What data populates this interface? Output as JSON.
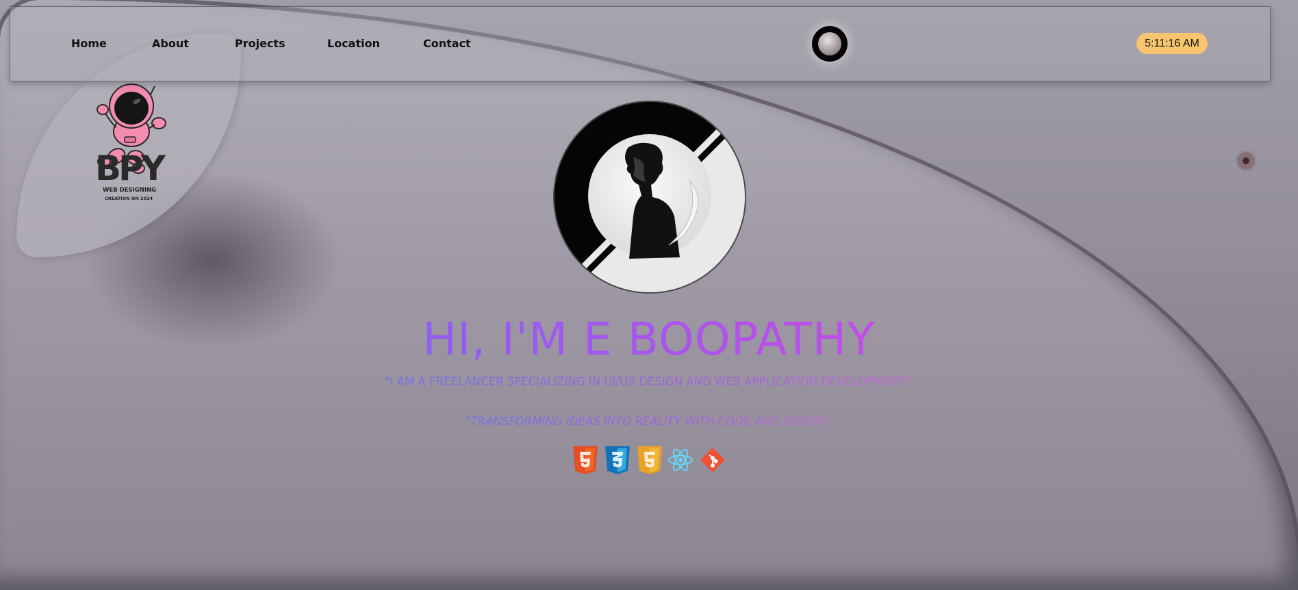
{
  "nav": {
    "items": [
      {
        "label": "Home"
      },
      {
        "label": "About"
      },
      {
        "label": "Projects"
      },
      {
        "label": "Location"
      },
      {
        "label": "Contact"
      }
    ],
    "clock": "5:11:16 AM"
  },
  "logo": {
    "text": "BPY",
    "line1": "WEB DESIGNING",
    "line2": "CREATION ON 2024"
  },
  "hero": {
    "heading": "HI, I'M E BOOPATHY",
    "tagline": "\"I AM A FREELANCER SPECIALIZING IN UI/UX DESIGN AND WEB APPLICATION DEVELOPMENT.\"",
    "subtag": "\"TRANSFORMING IDEAS INTO REALITY WITH CODE AND DESIGN.\""
  },
  "tech_icons": [
    "html5-icon",
    "css3-icon",
    "javascript-icon",
    "react-icon",
    "git-icon"
  ],
  "colors": {
    "clock_bg": "#f6c56d",
    "gradient_start": "#6a6cf2",
    "gradient_end": "#e05be0",
    "astronaut": "#f28cb0"
  }
}
